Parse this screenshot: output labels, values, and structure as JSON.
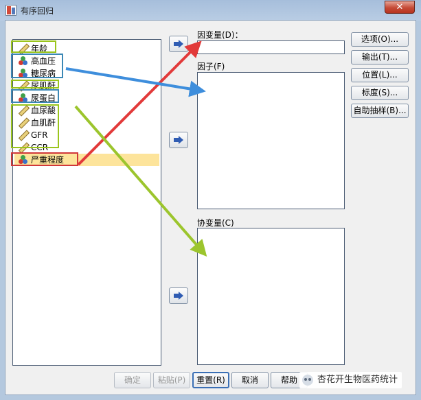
{
  "window": {
    "title": "有序回归",
    "close_icon": "close-icon",
    "close_glyph": "✕"
  },
  "variables": [
    {
      "label": "年龄",
      "icon": "scale-measure-icon",
      "selected": false
    },
    {
      "label": "高血压",
      "icon": "nominal-measure-icon",
      "selected": false
    },
    {
      "label": "糖尿病",
      "icon": "nominal-measure-icon",
      "selected": false
    },
    {
      "label": "尿肌酐",
      "icon": "scale-measure-icon",
      "selected": false
    },
    {
      "label": "尿蛋白",
      "icon": "nominal-measure-icon",
      "selected": false
    },
    {
      "label": "血尿酸",
      "icon": "scale-measure-icon",
      "selected": false
    },
    {
      "label": "血肌酐",
      "icon": "scale-measure-icon",
      "selected": false
    },
    {
      "label": "GFR",
      "icon": "scale-measure-icon",
      "selected": false
    },
    {
      "label": "CCR",
      "icon": "scale-measure-icon",
      "selected": false
    },
    {
      "label": "严重程度",
      "icon": "nominal-measure-icon",
      "selected": true
    }
  ],
  "targets": {
    "dependent": {
      "label": "因变量(D)：",
      "value": ""
    },
    "factors": {
      "label": "因子(F)",
      "items": []
    },
    "covariates": {
      "label": "协变量(C)",
      "items": []
    }
  },
  "side_buttons": [
    "选项(O)...",
    "输出(T)...",
    "位置(L)...",
    "标度(S)...",
    "自助抽样(B)..."
  ],
  "bottom_buttons": [
    {
      "label": "确定",
      "enabled": false
    },
    {
      "label": "粘贴(P)",
      "enabled": false
    },
    {
      "label": "重置(R)",
      "enabled": true
    },
    {
      "label": "取消",
      "enabled": true
    },
    {
      "label": "帮助",
      "enabled": true
    }
  ],
  "watermark": {
    "text": "杏花开生物医药统计"
  },
  "annotation_colors": {
    "green": "#9ac51c",
    "blue": "#3c88b5",
    "red": "#d0383a"
  }
}
